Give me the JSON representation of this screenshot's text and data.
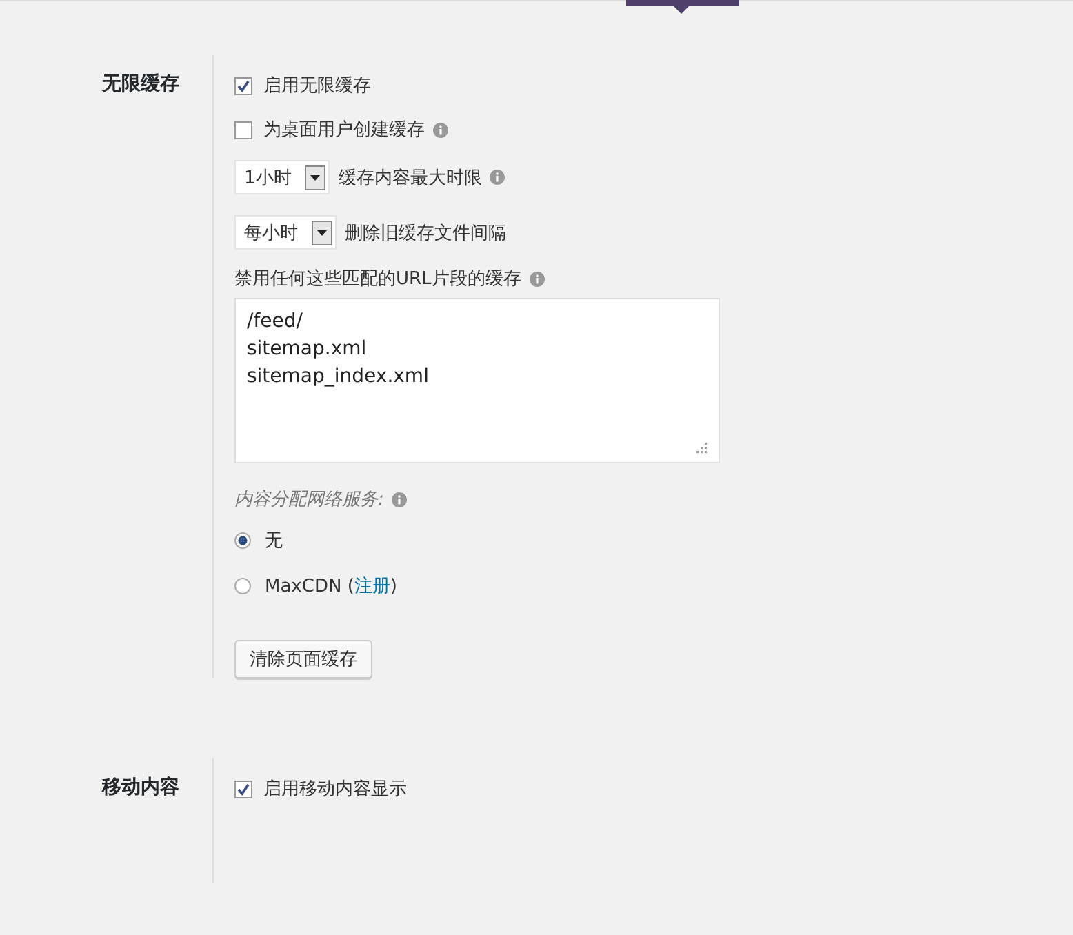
{
  "tab_indicator": {
    "selected": true
  },
  "sections": [
    {
      "title": "无限缓存",
      "items": [
        {
          "kind": "checkbox",
          "label": "启用无限缓存",
          "checked": true,
          "info": false
        },
        {
          "kind": "checkbox",
          "label": "为桌面用户创建缓存",
          "checked": false,
          "info": true
        },
        {
          "kind": "select",
          "value": "1小时",
          "label": "缓存内容最大时限",
          "info": true
        },
        {
          "kind": "select",
          "value": "每小时",
          "label": "删除旧缓存文件间隔",
          "info": false
        },
        {
          "kind": "textarea",
          "label": "禁用任何这些匹配的URL片段的缓存",
          "info": true,
          "lines": [
            "/feed/",
            "sitemap.xml",
            "sitemap_index.xml"
          ]
        },
        {
          "kind": "radiogroup",
          "label": "内容分配网络服务:",
          "info": true,
          "options": [
            {
              "label": "无",
              "selected": true
            },
            {
              "label": "MaxCDN (",
              "link": "注册",
              "suffix": ")",
              "selected": false
            }
          ]
        },
        {
          "kind": "button",
          "label": "清除页面缓存"
        }
      ]
    },
    {
      "title": "移动内容",
      "items": [
        {
          "kind": "checkbox",
          "label": "启用移动内容显示",
          "checked": true,
          "info": false
        }
      ]
    }
  ]
}
